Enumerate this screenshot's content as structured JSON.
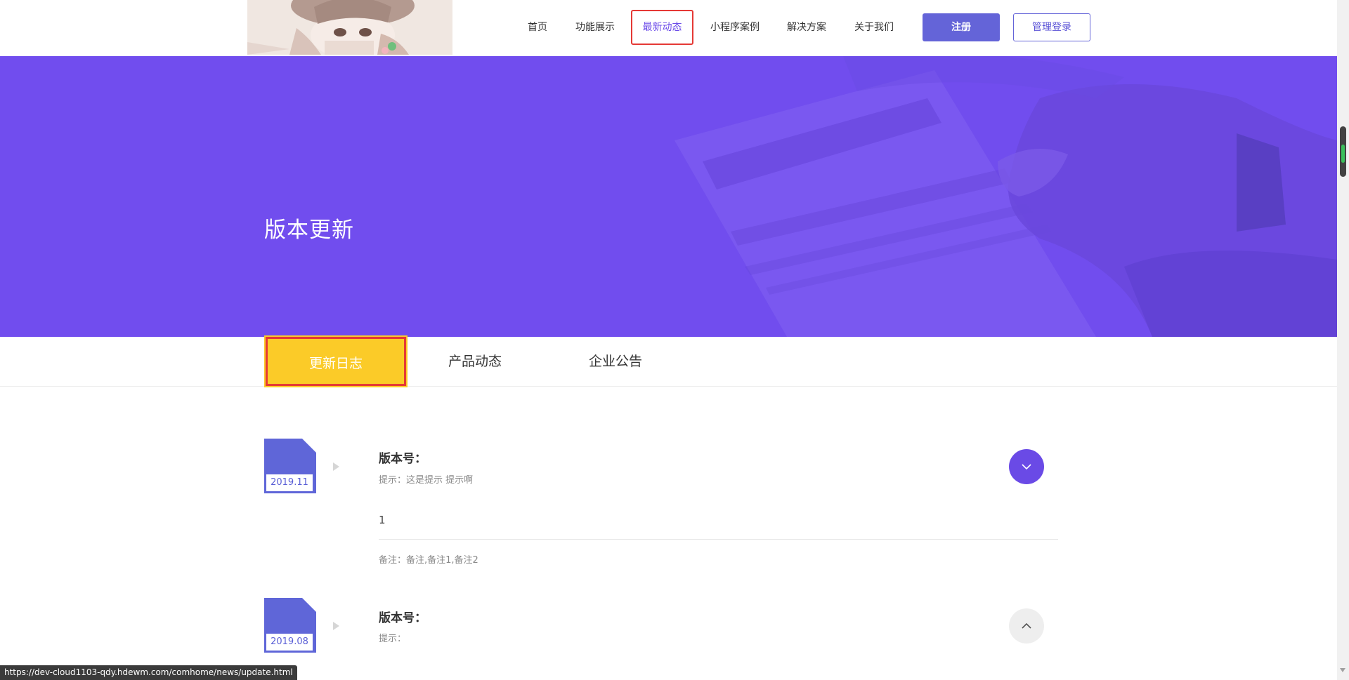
{
  "header": {
    "nav": [
      {
        "label": "首页",
        "active": false
      },
      {
        "label": "功能展示",
        "active": false
      },
      {
        "label": "最新动态",
        "active": true
      },
      {
        "label": "小程序案例",
        "active": false
      },
      {
        "label": "解决方案",
        "active": false
      },
      {
        "label": "关于我们",
        "active": false
      }
    ],
    "register_label": "注册",
    "login_label": "管理登录"
  },
  "banner": {
    "title": "版本更新",
    "color": "#714dee"
  },
  "tabs": [
    {
      "label": "更新日志",
      "active": true
    },
    {
      "label": "产品动态",
      "active": false
    },
    {
      "label": "企业公告",
      "active": false
    }
  ],
  "entries": [
    {
      "date": "2019.11",
      "title": "版本号：",
      "tip": "提示：这是提示 提示啊",
      "body": "1",
      "note": "备注：备注,备注1,备注2",
      "expanded": true,
      "toggle_icon": "chevron-down-icon"
    },
    {
      "date": "2019.08",
      "title": "版本号：",
      "tip": "提示：",
      "expanded": false,
      "toggle_icon": "chevron-up-icon"
    }
  ],
  "status_url": "https://dev-cloud1103-qdy.hdewm.com/comhome/news/update.html",
  "colors": {
    "accent": "#6c4ce8",
    "tab_active": "#fbcb28",
    "highlight": "#e53935",
    "button": "#6464d8"
  }
}
